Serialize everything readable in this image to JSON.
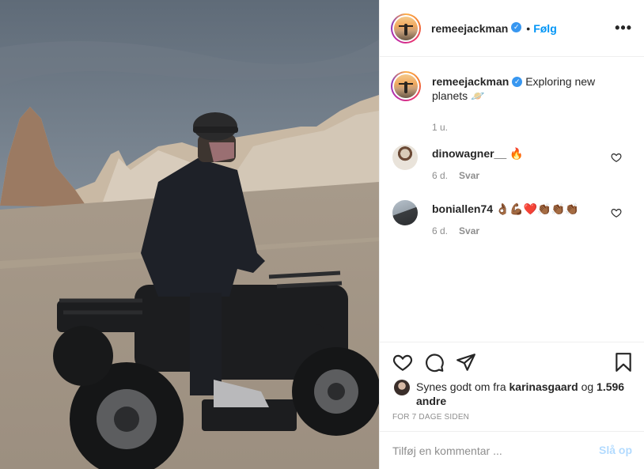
{
  "post": {
    "author": "remeejackman",
    "verified": true,
    "separator": "•",
    "follow_label": "Følg",
    "more_label": "•••"
  },
  "caption": {
    "username": "remeejackman",
    "text": "Exploring new planets 🪐",
    "time": "1 u."
  },
  "comments": [
    {
      "username": "dinowagner__",
      "text": "🔥",
      "time": "6 d.",
      "reply_label": "Svar"
    },
    {
      "username": "boniallen74",
      "text": "👌🏾💪🏾❤️👏🏾👏🏾👏🏾",
      "time": "6 d.",
      "reply_label": "Svar"
    }
  ],
  "likes": {
    "prefix": "Synes godt om fra",
    "first_liker": "karinasgaard",
    "conjunction": "og",
    "others": "1.596 andre"
  },
  "timestamp": "FOR 7 DAGE SIDEN",
  "comment_box": {
    "placeholder": "Tilføj en kommentar ...",
    "post_label": "Slå op"
  },
  "icons": {
    "like": "heart-icon",
    "comment": "comment-bubble-icon",
    "share": "paper-plane-icon",
    "save": "bookmark-icon",
    "more": "ellipsis-icon",
    "verified": "verified-badge-icon"
  },
  "colors": {
    "accent": "#0095f6",
    "verified": "#3897f0",
    "muted": "#8e8e8e",
    "post_disabled": "#b3dbff"
  }
}
